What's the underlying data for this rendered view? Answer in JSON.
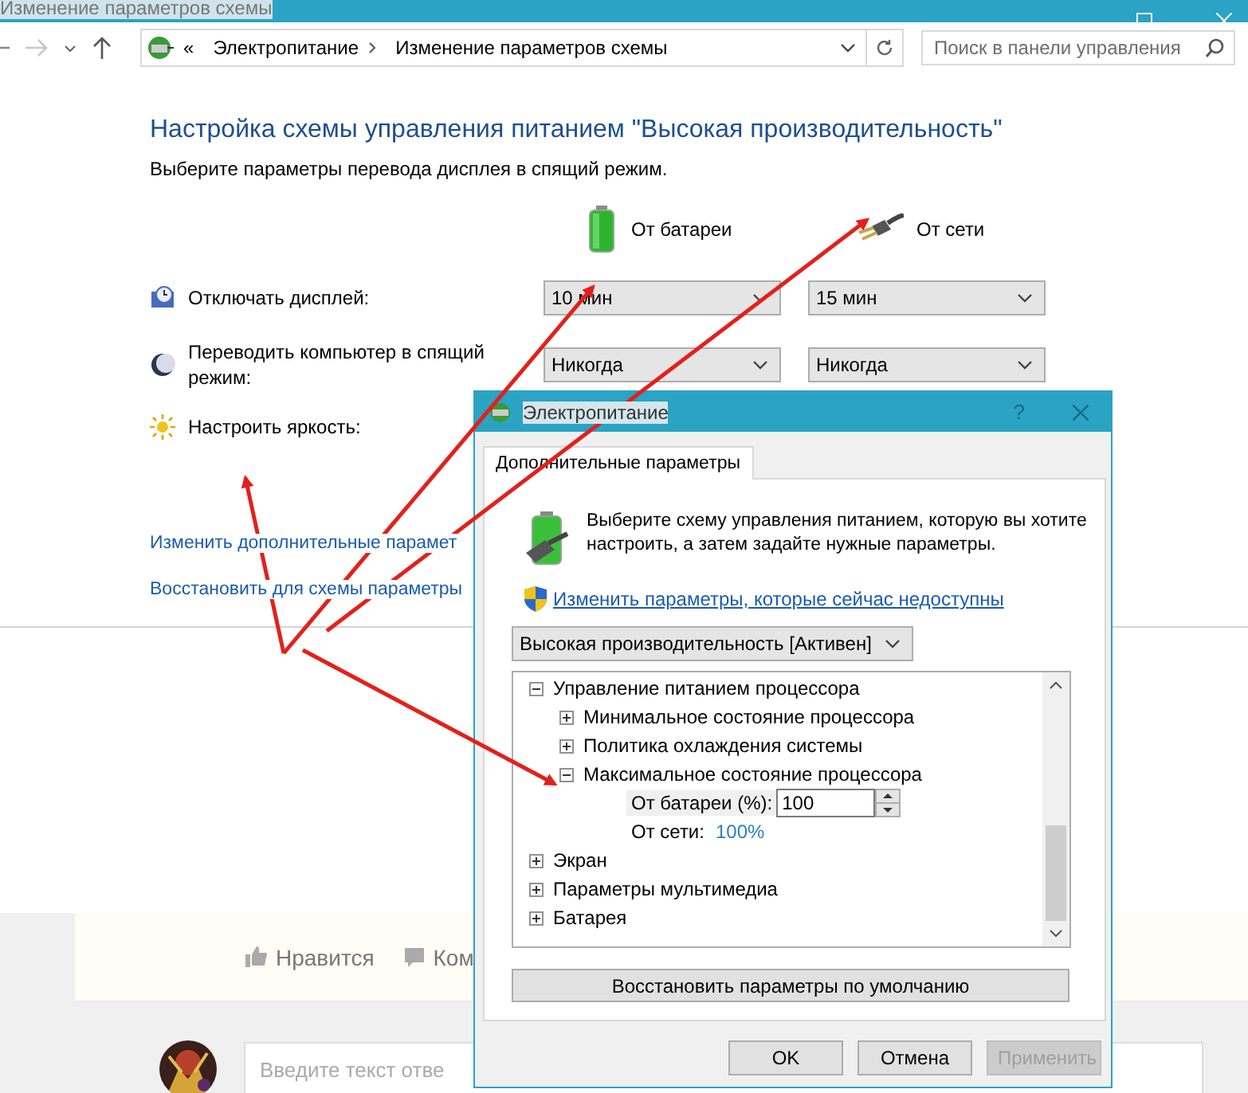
{
  "window": {
    "title": "Изменение параметров схемы"
  },
  "address_bar": {
    "prefix": "«",
    "crumbs": [
      "Электропитание",
      "Изменение параметров схемы"
    ]
  },
  "search": {
    "placeholder": "Поиск в панели управления"
  },
  "heading": "Настройка схемы управления питанием \"Высокая производительность\"",
  "subtitle": "Выберите параметры перевода дисплея в спящий режим.",
  "columns": [
    {
      "kind": "battery",
      "label": "От батареи"
    },
    {
      "kind": "plug",
      "label": "От сети"
    }
  ],
  "settings": [
    {
      "kind": "display",
      "label": "Отключать дисплей:",
      "values": [
        "10 мин",
        "15 мин"
      ]
    },
    {
      "kind": "sleep",
      "label": "Переводить компьютер в спящий режим:",
      "values": [
        "Никогда",
        "Никогда"
      ]
    },
    {
      "kind": "brightness",
      "label": "Настроить яркость:"
    }
  ],
  "links": [
    "Изменить дополнительные парамет",
    "Восстановить для схемы параметры"
  ],
  "post": {
    "actions": [
      {
        "kind": "like",
        "label": "Нравится"
      },
      {
        "kind": "comment",
        "label": "Ком"
      }
    ],
    "reply": {
      "placeholder": "Введите текст отве"
    }
  },
  "dialog": {
    "title": "Электропитание",
    "help": "?",
    "tabs": [
      {
        "label": "Дополнительные параметры",
        "selected": true
      }
    ],
    "intro": "Выберите схему управления питанием, которую вы хотите настроить, а затем задайте нужные параметры.",
    "admin_link": "Изменить параметры, которые сейчас недоступны",
    "plan": "Высокая производительность [Активен]",
    "tree": [
      {
        "kind": "group",
        "label": "Управление питанием процессора",
        "expanded": true,
        "children": [
          {
            "kind": "group",
            "label": "Минимальное состояние процессора",
            "expanded": false
          },
          {
            "kind": "group",
            "label": "Политика охлаждения системы",
            "expanded": false
          },
          {
            "kind": "group",
            "label": "Максимальное состояние процессора",
            "expanded": true,
            "children": [
              {
                "kind": "spin",
                "label": "От батареи (%):",
                "value": "100"
              },
              {
                "kind": "value",
                "label": "От сети:",
                "value": "100%"
              }
            ]
          }
        ]
      },
      {
        "kind": "group",
        "label": "Экран",
        "expanded": false
      },
      {
        "kind": "group",
        "label": "Параметры мультимедиа",
        "expanded": false
      },
      {
        "kind": "group",
        "label": "Батарея",
        "expanded": false
      }
    ],
    "restore_button": "Восстановить параметры по умолчанию",
    "buttons": [
      {
        "label": "OK",
        "disabled": false
      },
      {
        "label": "Отмена",
        "disabled": false
      },
      {
        "label": "Применить",
        "disabled": true
      }
    ]
  }
}
